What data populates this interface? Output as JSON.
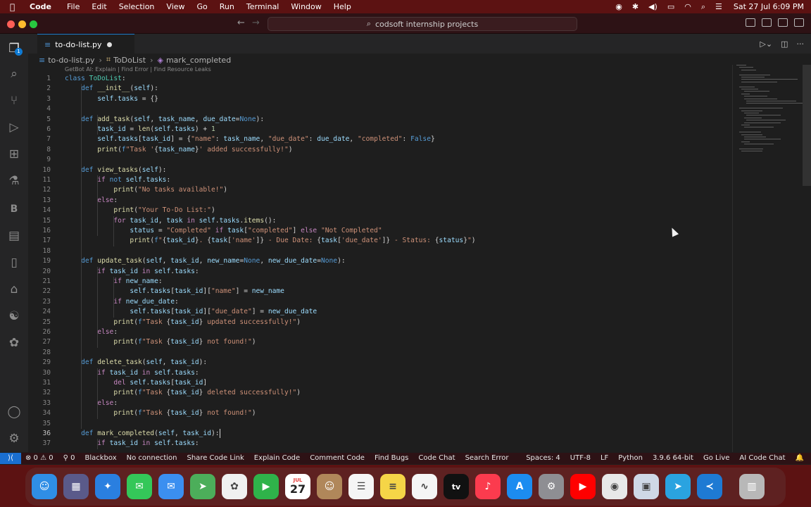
{
  "menubar": {
    "app": "Code",
    "items": [
      "File",
      "Edit",
      "Selection",
      "View",
      "Go",
      "Run",
      "Terminal",
      "Window",
      "Help"
    ],
    "clock": "Sat 27 Jul  6:09 PM",
    "icons": [
      "record-icon",
      "bluetooth-icon",
      "volume-icon",
      "battery-icon",
      "wifi-icon",
      "spotlight-icon",
      "control-center-icon"
    ]
  },
  "window": {
    "search": "codsoft internship projects"
  },
  "tab": {
    "filename": "to-do-list.py"
  },
  "breadcrumb": {
    "file": "to-do-list.py",
    "class": "ToDoList",
    "method": "mark_completed"
  },
  "codelens": "GetBot AI: Explain | Find Error | Find Resource Leaks",
  "code": [
    {
      "n": "1",
      "html": "<span class='kw'>class</span> <span class='cl'>ToDoList</span>:"
    },
    {
      "n": "2",
      "html": "    <span class='kw'>def</span> <span class='fn'>__init__</span>(<span class='vr'>self</span>):"
    },
    {
      "n": "3",
      "html": "        <span class='vr'>self</span>.<span class='vr'>tasks</span> = {}"
    },
    {
      "n": "4",
      "html": ""
    },
    {
      "n": "5",
      "html": "    <span class='kw'>def</span> <span class='fn'>add_task</span>(<span class='vr'>self</span>, <span class='vr'>task_name</span>, <span class='vr'>due_date</span>=<span class='kw'>None</span>):"
    },
    {
      "n": "6",
      "html": "        <span class='vr'>task_id</span> = <span class='fn'>len</span>(<span class='vr'>self</span>.<span class='vr'>tasks</span>) + <span class='nm'>1</span>"
    },
    {
      "n": "7",
      "html": "        <span class='vr'>self</span>.<span class='vr'>tasks</span>[<span class='vr'>task_id</span>] = {<span class='st'>\"name\"</span>: <span class='vr'>task_name</span>, <span class='st'>\"due_date\"</span>: <span class='vr'>due_date</span>, <span class='st'>\"completed\"</span>: <span class='kw'>False</span>}"
    },
    {
      "n": "8",
      "html": "        <span class='fn'>print</span>(<span class='kw'>f</span><span class='st'>\"Task '</span>{<span class='vr'>task_name</span>}<span class='st'>' added successfully!\"</span>)"
    },
    {
      "n": "9",
      "html": ""
    },
    {
      "n": "10",
      "html": "    <span class='kw'>def</span> <span class='fn'>view_tasks</span>(<span class='vr'>self</span>):"
    },
    {
      "n": "11",
      "html": "        <span class='kc'>if</span> <span class='kw'>not</span> <span class='vr'>self</span>.<span class='vr'>tasks</span>:"
    },
    {
      "n": "12",
      "html": "            <span class='fn'>print</span>(<span class='st'>\"No tasks available!\"</span>)"
    },
    {
      "n": "13",
      "html": "        <span class='kc'>else</span>:"
    },
    {
      "n": "14",
      "html": "            <span class='fn'>print</span>(<span class='st'>\"Your To-Do List:\"</span>)"
    },
    {
      "n": "15",
      "html": "            <span class='kc'>for</span> <span class='vr'>task_id</span>, <span class='vr'>task</span> <span class='kc'>in</span> <span class='vr'>self</span>.<span class='vr'>tasks</span>.<span class='fn'>items</span>():"
    },
    {
      "n": "16",
      "html": "                <span class='vr'>status</span> = <span class='st'>\"Completed\"</span> <span class='kc'>if</span> <span class='vr'>task</span>[<span class='st'>\"completed\"</span>] <span class='kc'>else</span> <span class='st'>\"Not Completed\"</span>"
    },
    {
      "n": "17",
      "html": "                <span class='fn'>print</span>(<span class='kw'>f</span><span class='st'>\"</span>{<span class='vr'>task_id</span>}<span class='st'>. </span>{<span class='vr'>task</span>[<span class='st'>'name'</span>]}<span class='st'> - Due Date: </span>{<span class='vr'>task</span>[<span class='st'>'due_date'</span>]}<span class='st'> - Status: </span>{<span class='vr'>status</span>}<span class='st'>\"</span>)"
    },
    {
      "n": "18",
      "html": ""
    },
    {
      "n": "19",
      "html": "    <span class='kw'>def</span> <span class='fn'>update_task</span>(<span class='vr'>self</span>, <span class='vr'>task_id</span>, <span class='vr'>new_name</span>=<span class='kw'>None</span>, <span class='vr'>new_due_date</span>=<span class='kw'>None</span>):"
    },
    {
      "n": "20",
      "html": "        <span class='kc'>if</span> <span class='vr'>task_id</span> <span class='kc'>in</span> <span class='vr'>self</span>.<span class='vr'>tasks</span>:"
    },
    {
      "n": "21",
      "html": "            <span class='kc'>if</span> <span class='vr'>new_name</span>:"
    },
    {
      "n": "22",
      "html": "                <span class='vr'>self</span>.<span class='vr'>tasks</span>[<span class='vr'>task_id</span>][<span class='st'>\"name\"</span>] = <span class='vr'>new_name</span>"
    },
    {
      "n": "23",
      "html": "            <span class='kc'>if</span> <span class='vr'>new_due_date</span>:"
    },
    {
      "n": "24",
      "html": "                <span class='vr'>self</span>.<span class='vr'>tasks</span>[<span class='vr'>task_id</span>][<span class='st'>\"due_date\"</span>] = <span class='vr'>new_due_date</span>"
    },
    {
      "n": "25",
      "html": "            <span class='fn'>print</span>(<span class='kw'>f</span><span class='st'>\"Task </span>{<span class='vr'>task_id</span>}<span class='st'> updated successfully!\"</span>)"
    },
    {
      "n": "26",
      "html": "        <span class='kc'>else</span>:"
    },
    {
      "n": "27",
      "html": "            <span class='fn'>print</span>(<span class='kw'>f</span><span class='st'>\"Task </span>{<span class='vr'>task_id</span>}<span class='st'> not found!\"</span>)"
    },
    {
      "n": "28",
      "html": ""
    },
    {
      "n": "29",
      "html": "    <span class='kw'>def</span> <span class='fn'>delete_task</span>(<span class='vr'>self</span>, <span class='vr'>task_id</span>):"
    },
    {
      "n": "30",
      "html": "        <span class='kc'>if</span> <span class='vr'>task_id</span> <span class='kc'>in</span> <span class='vr'>self</span>.<span class='vr'>tasks</span>:"
    },
    {
      "n": "31",
      "html": "            <span class='kc'>del</span> <span class='vr'>self</span>.<span class='vr'>tasks</span>[<span class='vr'>task_id</span>]"
    },
    {
      "n": "32",
      "html": "            <span class='fn'>print</span>(<span class='kw'>f</span><span class='st'>\"Task </span>{<span class='vr'>task_id</span>}<span class='st'> deleted successfully!\"</span>)"
    },
    {
      "n": "33",
      "html": "        <span class='kc'>else</span>:"
    },
    {
      "n": "34",
      "html": "            <span class='fn'>print</span>(<span class='kw'>f</span><span class='st'>\"Task </span>{<span class='vr'>task_id</span>}<span class='st'> not found!\"</span>)"
    },
    {
      "n": "35",
      "html": ""
    },
    {
      "n": "36",
      "html": "    <span class='kw'>def</span> <span class='fn'>mark_completed</span>(<span class='vr'>self</span>, <span class='vr'>task_id</span>):"
    },
    {
      "n": "37",
      "html": "        <span class='kc'>if</span> <span class='vr'>task_id</span> <span class='kc'>in</span> <span class='vr'>self</span>.<span class='vr'>tasks</span>:"
    }
  ],
  "current_line": "36",
  "statusbar": {
    "problems": "⊗ 0 ⚠ 0",
    "ports": "⚲ 0",
    "left": [
      "Blackbox",
      "No connection",
      "Share Code Link",
      "Explain Code",
      "Comment Code",
      "Find Bugs",
      "Code Chat",
      "Search Error"
    ],
    "right": [
      "Spaces: 4",
      "UTF-8",
      "LF",
      "Python",
      "3.9.6 64-bit",
      "Go Live",
      "AI Code Chat"
    ]
  },
  "dock": {
    "date_month": "JUL",
    "date_day": "27",
    "tv_label": "tv",
    "apps": [
      {
        "name": "finder",
        "color": "#2f8ee6"
      },
      {
        "name": "launchpad",
        "color": "#5a5a8a"
      },
      {
        "name": "safari",
        "color": "#2a7fe0"
      },
      {
        "name": "messages",
        "color": "#34c759"
      },
      {
        "name": "mail",
        "color": "#3b8ff0"
      },
      {
        "name": "maps",
        "color": "#4cae5a"
      },
      {
        "name": "photos",
        "color": "#f0f0f0"
      },
      {
        "name": "facetime",
        "color": "#2fb34a"
      },
      {
        "name": "calendar",
        "color": "#ffffff"
      },
      {
        "name": "contacts",
        "color": "#b0875a"
      },
      {
        "name": "reminders",
        "color": "#f5f5f5"
      },
      {
        "name": "notes",
        "color": "#f5d547"
      },
      {
        "name": "freeform",
        "color": "#f5f5f5"
      },
      {
        "name": "apple-tv",
        "color": "#111111"
      },
      {
        "name": "music",
        "color": "#fb3b4e"
      },
      {
        "name": "app-store",
        "color": "#1c8cf0"
      },
      {
        "name": "system-settings",
        "color": "#8e8e93"
      },
      {
        "name": "youtube",
        "color": "#ff0000"
      },
      {
        "name": "chrome",
        "color": "#e8e8e8"
      },
      {
        "name": "preview",
        "color": "#cfd8e6"
      },
      {
        "name": "telegram",
        "color": "#2aa3e0"
      },
      {
        "name": "vscode",
        "color": "#1e7ad3"
      },
      {
        "name": "trash",
        "color": "#b8b8b8"
      }
    ]
  }
}
